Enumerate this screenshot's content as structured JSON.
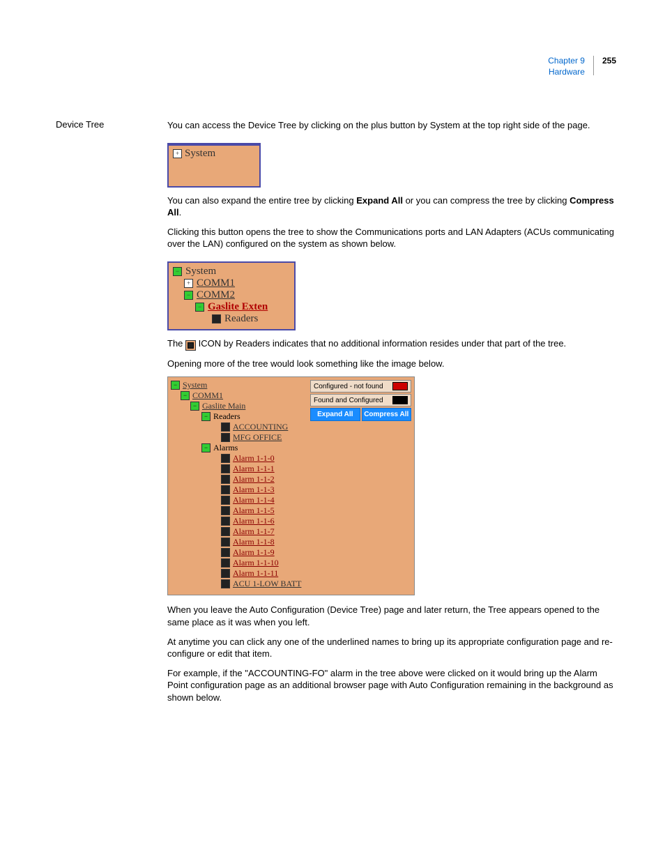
{
  "header": {
    "chapter": "Chapter 9",
    "section": "Hardware",
    "page": "255"
  },
  "sectionLabel": "Device Tree",
  "p1": "You can access the Device Tree by clicking on the plus button by System at the top right side of the page.",
  "fig1System": "System",
  "p2a": "You can also expand the entire tree by clicking ",
  "p2b_bold": "Expand All",
  "p2c": " or you can compress the tree by clicking ",
  "p2d_bold": "Compress All",
  "p2e": ".",
  "p3": "Clicking this button opens the tree to show the Communications ports and LAN Adapters (ACUs communicating over the LAN) configured on the system as shown below.",
  "fig2": {
    "system": "System",
    "comm1": "COMM1",
    "comm2": "COMM2",
    "gaslite": "Gaslite Exten",
    "readers": "Readers"
  },
  "p4a": "The ",
  "p4b": " ICON by Readers indicates that no additional information resides under that part of the tree.",
  "p5": "Opening more of the tree would look something like the image below.",
  "fig3": {
    "legend1": "Configured - not found",
    "legend2": "Found and Configured",
    "btnExpand": "Expand All",
    "btnCompress": "Compress All",
    "system": "System",
    "comm1": "COMM1",
    "gasliteMain": "Gaslite Main",
    "readers": "Readers",
    "accounting": "ACCOUNTING",
    "mfg": "MFG OFFICE",
    "alarms": "Alarms",
    "alarmItems": [
      "Alarm 1-1-0",
      "Alarm 1-1-1",
      "Alarm 1-1-2",
      "Alarm 1-1-3",
      "Alarm 1-1-4",
      "Alarm 1-1-5",
      "Alarm 1-1-6",
      "Alarm 1-1-7",
      "Alarm 1-1-8",
      "Alarm 1-1-9",
      "Alarm 1-1-10",
      "Alarm 1-1-11"
    ],
    "acu": "ACU 1-LOW BATT"
  },
  "p6": "When you leave the Auto Configuration (Device Tree) page and later return, the Tree appears opened to the same place as it was when you left.",
  "p7": "At anytime you can click any one of the underlined names to bring up its appropriate configuration page and re-configure or edit that item.",
  "p8": "For example, if the \"ACCOUNTING-FO\" alarm in the tree above were clicked on it would bring up the Alarm Point configuration page as an additional browser page with Auto Configuration remaining in the background as shown below."
}
